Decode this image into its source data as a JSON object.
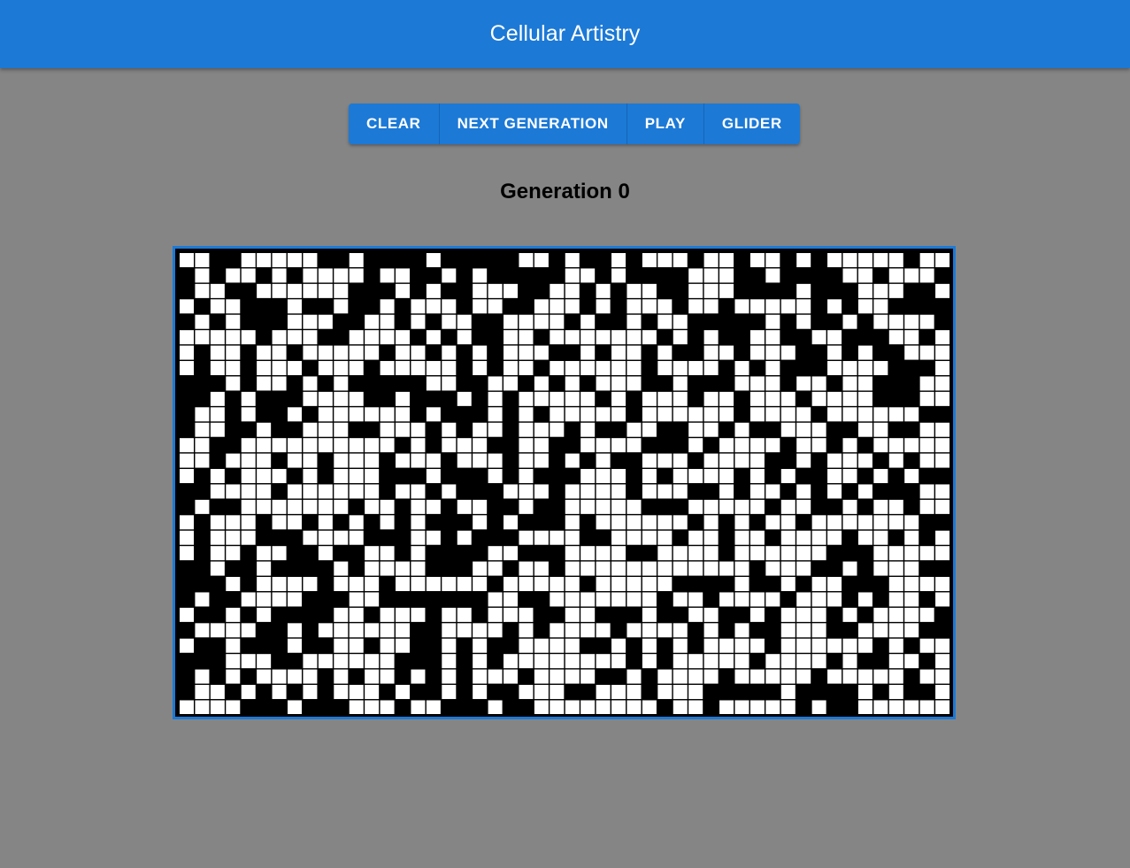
{
  "app": {
    "title": "Cellular Artistry"
  },
  "toolbar": {
    "clear_label": "CLEAR",
    "next_label": "NEXT GENERATION",
    "play_label": "PLAY",
    "glider_label": "GLIDER"
  },
  "status": {
    "generation_text": "Generation 0"
  },
  "board": {
    "columns": 50,
    "rows": 30,
    "alive_color": "#ffffff",
    "dead_color": "#000000",
    "grid_color": "#000000",
    "cells": [
      "11001111100100001000001101001011101101101011111011",
      "01011010111101100101000001101000011100100001101110",
      "01100111111000101001110011010110011100001000111001",
      "10110001001001011101100111010111011011111010110000",
      "01010001110011010110011110100101100000101001011110",
      "11111011100111101010011011111110101001100110001101",
      "10110110111110110101011100101101001101110010100111",
      "10110111011101111101011011111101111010100011110001",
      "00010110101000001100110101011100100011101101100011",
      "00101000111100100010101111101011101101110111100011",
      "01101001011111101000101011111011111101111011111100",
      "01100100111001110101101110100110011010011100110011",
      "11001111111111010111001100111100010111101101011111",
      "11011101101110111011101101010011101111001011101011",
      "10101110101110001000101000111010111101010011010100",
      "00111101111110110100011101111011100101101010100011",
      "01001111111011011011001001111100011111011001011011",
      "10111011010101010001010001011111101010110111111100",
      "10111000111100011010001111001111011011011110110101",
      "10110110010011010000110001111001111011111100011111",
      "00100100001011110001101101111111111110111001011100",
      "00010111101110111111011111011111000010010110001111",
      "01001111000110000000110011111110110111101110101101",
      "10010100001101110110111001100010011001011101011110",
      "01111001011111100111101011110111101010011100111100",
      "10010001001101100101001111001010101111011111101011",
      "00011100111111000101011111111010111110111101001101",
      "01010111101011010101110111100101111011111011111011",
      "01101010101110100101001110011101110000010000101001",
      "11110001000111011000100111111110110111110100111111"
    ]
  }
}
